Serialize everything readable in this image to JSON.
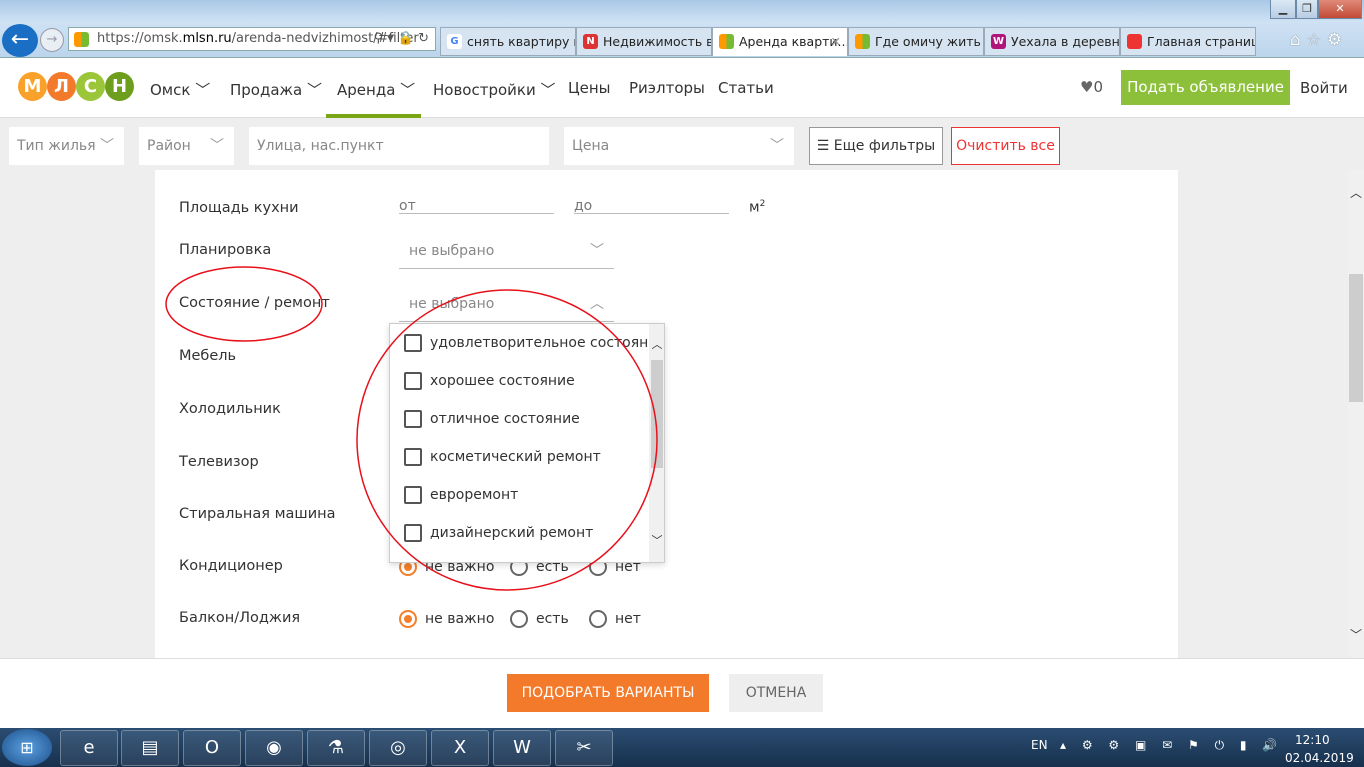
{
  "browser": {
    "url_prefix": "https://omsk.",
    "url_domain": "mlsn.ru",
    "url_path": "/arenda-nedvizhimost/#filter",
    "tabs": [
      {
        "label": "снять квартиру в ...",
        "icon": "google-icon"
      },
      {
        "label": "Недвижимость в ...",
        "icon": "n1-icon"
      },
      {
        "label": "Аренда кварти...",
        "icon": "mlsn-icon",
        "active": true
      },
      {
        "label": "Где омичу жить х...",
        "icon": "mlsn-icon"
      },
      {
        "label": "Уехала в деревню...",
        "icon": "w-icon"
      },
      {
        "label": "Главная страница...",
        "icon": "site-icon"
      }
    ]
  },
  "site": {
    "logo": [
      "М",
      "Л",
      "С",
      "Н"
    ],
    "nav": [
      "Омск",
      "Продажа",
      "Аренда",
      "Новостройки",
      "Цены",
      "Риэлторы",
      "Статьи"
    ],
    "favorites_count": "0",
    "post_button": "Подать объявление",
    "login": "Войти"
  },
  "filters": {
    "type": "Тип жилья",
    "district": "Район",
    "street_placeholder": "Улица, нас.пункт",
    "price": "Цена",
    "more": "Еще фильтры",
    "clear": "Очистить все"
  },
  "form": {
    "kitchen_label": "Площадь кухни",
    "from": "от",
    "to": "до",
    "unit": "м",
    "unit_sup": "2",
    "layout_label": "Планировка",
    "layout_value": "не выбрано",
    "condition_label": "Состояние / ремонт",
    "condition_value": "не выбрано",
    "condition_options": [
      "удовлетворительное состояние",
      "хорошее состояние",
      "отличное состояние",
      "косметический ремонт",
      "евроремонт",
      "дизайнерский ремонт"
    ],
    "rows": [
      "Мебель",
      "Холодильник",
      "Телевизор",
      "Стиральная машина",
      "Кондиционер",
      "Балкон/Лоджия"
    ],
    "radio_options": [
      "не важно",
      "есть",
      "нет"
    ],
    "selected_radio": "не важно"
  },
  "actions": {
    "submit": "ПОДОБРАТЬ ВАРИАНТЫ",
    "cancel": "ОТМЕНА"
  },
  "taskbar": {
    "lang": "EN",
    "time": "12:10",
    "date": "02.04.2019"
  },
  "colors": {
    "accent_orange": "#f47a2b",
    "accent_green": "#8cc03a",
    "annotation_red": "#e8101a"
  }
}
